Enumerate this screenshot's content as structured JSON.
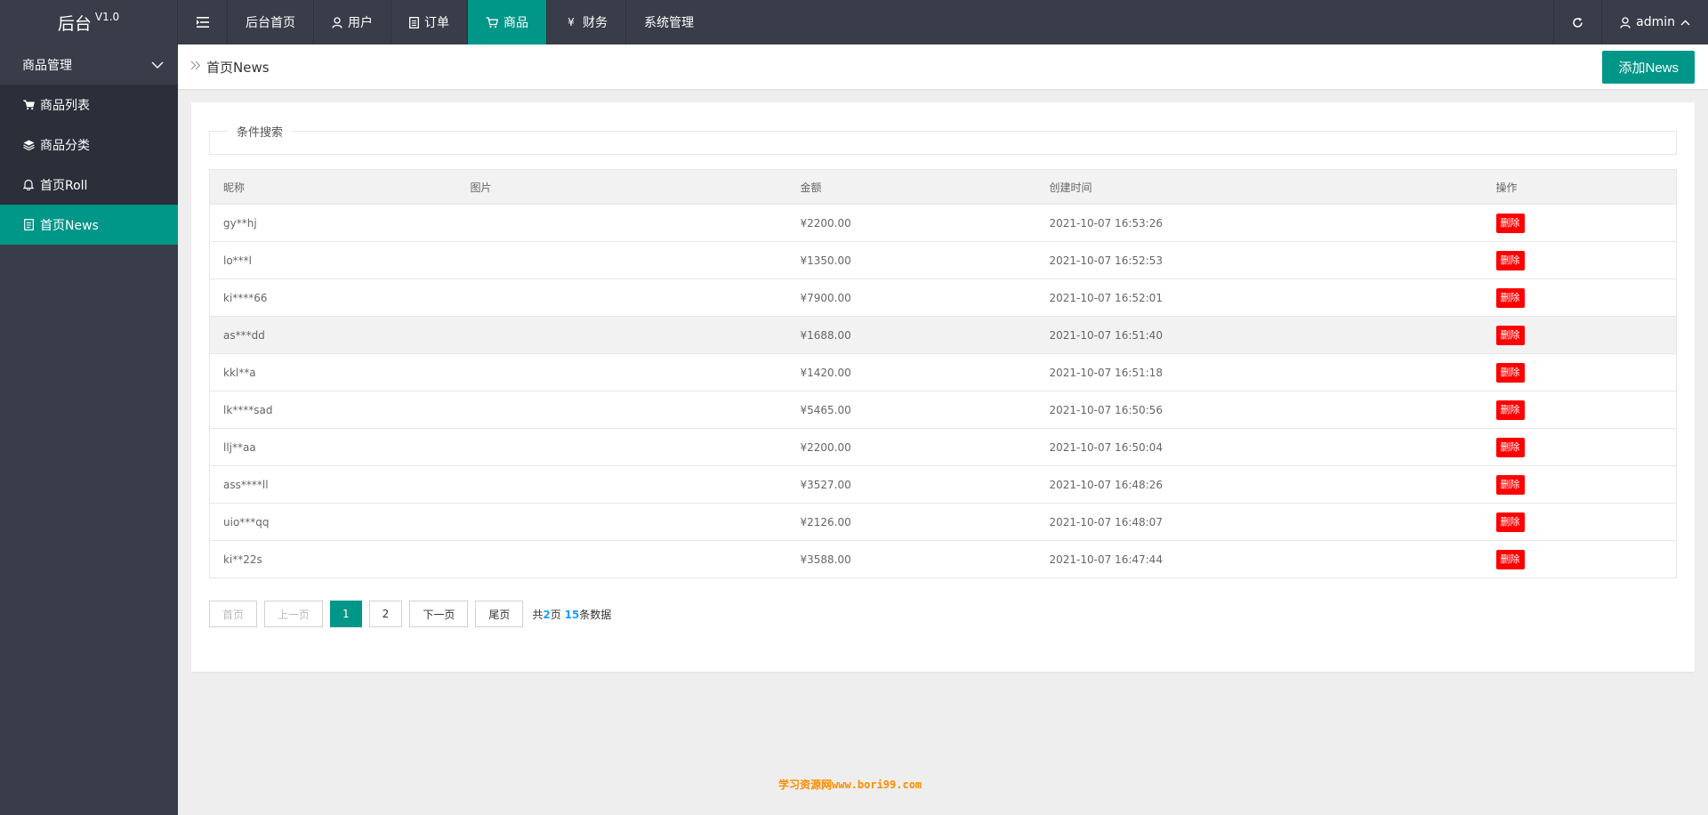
{
  "app": {
    "title": "后台",
    "version": "V1.0"
  },
  "topnav": {
    "items": [
      {
        "label": "后台首页",
        "icon": ""
      },
      {
        "label": "用户",
        "icon": "user-icon"
      },
      {
        "label": "订单",
        "icon": "document-icon"
      },
      {
        "label": "商品",
        "icon": "cart-icon",
        "active": true
      },
      {
        "label": "财务",
        "icon": "yen-icon"
      },
      {
        "label": "系统管理",
        "icon": ""
      }
    ],
    "user": "admin"
  },
  "sidebar": {
    "group": "商品管理",
    "items": [
      {
        "label": "商品列表",
        "icon": "cart-icon"
      },
      {
        "label": "商品分类",
        "icon": "layers-icon"
      },
      {
        "label": "首页Roll",
        "icon": "bell-icon"
      },
      {
        "label": "首页News",
        "icon": "note-icon",
        "active": true
      }
    ]
  },
  "breadcrumb": {
    "current": "首页News"
  },
  "toolbar": {
    "add_label": "添加News"
  },
  "search": {
    "legend": "条件搜索"
  },
  "table": {
    "headers": [
      "昵称",
      "图片",
      "金额",
      "创建时间",
      "操作"
    ],
    "delete_label": "删除",
    "rows": [
      {
        "name": "gy**hj",
        "image": "",
        "amount": "¥2200.00",
        "time": "2021-10-07 16:53:26"
      },
      {
        "name": "lo***l",
        "image": "",
        "amount": "¥1350.00",
        "time": "2021-10-07 16:52:53"
      },
      {
        "name": "ki****66",
        "image": "",
        "amount": "¥7900.00",
        "time": "2021-10-07 16:52:01"
      },
      {
        "name": "as***dd",
        "image": "",
        "amount": "¥1688.00",
        "time": "2021-10-07 16:51:40"
      },
      {
        "name": "kkl**a",
        "image": "",
        "amount": "¥1420.00",
        "time": "2021-10-07 16:51:18"
      },
      {
        "name": "lk****sad",
        "image": "",
        "amount": "¥5465.00",
        "time": "2021-10-07 16:50:56"
      },
      {
        "name": "llj**aa",
        "image": "",
        "amount": "¥2200.00",
        "time": "2021-10-07 16:50:04"
      },
      {
        "name": "ass****ll",
        "image": "",
        "amount": "¥3527.00",
        "time": "2021-10-07 16:48:26"
      },
      {
        "name": "uio***qq",
        "image": "",
        "amount": "¥2126.00",
        "time": "2021-10-07 16:48:07"
      },
      {
        "name": "ki**22s",
        "image": "",
        "amount": "¥3588.00",
        "time": "2021-10-07 16:47:44"
      }
    ]
  },
  "pager": {
    "first": "首页",
    "prev": "上一页",
    "page1": "1",
    "page2": "2",
    "next": "下一页",
    "last": "尾页",
    "info_prefix": "共",
    "total_pages": "2",
    "pages_suffix": "页",
    "total_items": "15",
    "items_suffix": "条数据"
  },
  "watermark": "学习资源网www.bori99.com",
  "colors": {
    "accent": "#009688",
    "topbar": "#393d49",
    "danger": "#ff0000",
    "link": "#1e9fff"
  }
}
